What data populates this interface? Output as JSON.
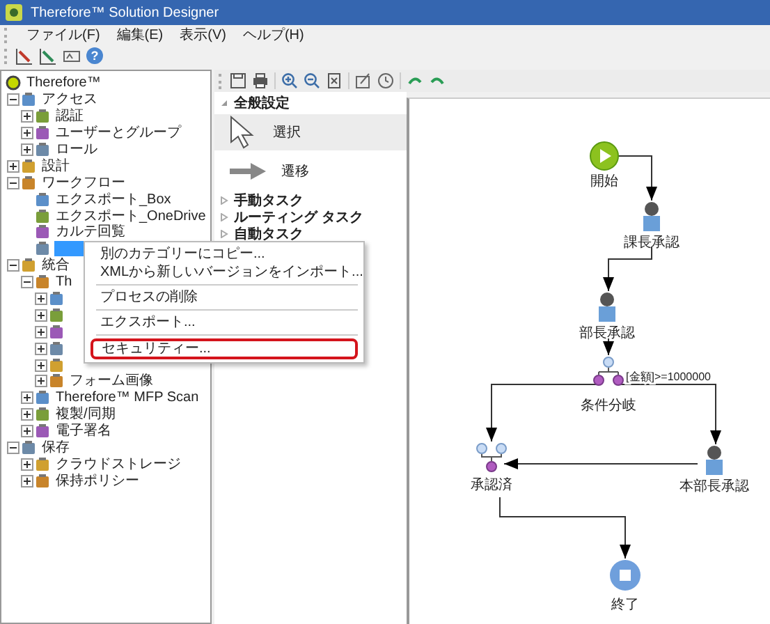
{
  "window": {
    "title": "Therefore™ Solution Designer"
  },
  "menu": [
    "ファイル(F)",
    "編集(E)",
    "表示(V)",
    "ヘルプ(H)"
  ],
  "toolbar": {
    "help": "?"
  },
  "tree": [
    {
      "label": "Therefore™",
      "children": [
        {
          "label": "アクセス",
          "expanded": true,
          "children": [
            {
              "label": "認証",
              "expanded": false
            },
            {
              "label": "ユーザーとグループ",
              "expanded": false
            },
            {
              "label": "ロール",
              "expanded": false
            }
          ]
        },
        {
          "label": "設計",
          "expanded": false
        },
        {
          "label": "ワークフロー",
          "expanded": true,
          "children": [
            {
              "label": "エクスポート_Box",
              "selected": false
            },
            {
              "label": "エクスポート_OneDrive",
              "selected": false
            },
            {
              "label": "カルテ回覧",
              "selected": false
            },
            {
              "selected": true
            }
          ]
        },
        {
          "label": "統合",
          "expanded": true,
          "children": [
            {
              "label": "Th",
              "expanded": true,
              "children": [
                {
                  "expanded": false
                },
                {
                  "expanded": false
                },
                {
                  "expanded": false
                },
                {
                  "expanded": false
                },
                {
                  "expanded": false
                },
                {
                  "label": "フォーム画像",
                  "expanded": false
                }
              ]
            },
            {
              "label": "Therefore™ MFP Scan",
              "expanded": false
            },
            {
              "label": "複製/同期",
              "expanded": false
            },
            {
              "label": "電子署名",
              "expanded": false
            }
          ]
        },
        {
          "label": "保存",
          "expanded": true,
          "children": [
            {
              "label": "クラウドストレージ",
              "expanded": false
            },
            {
              "label": "保持ポリシー",
              "expanded": false
            }
          ]
        }
      ]
    }
  ],
  "context_menu": [
    {
      "kind": "item",
      "label": "別のカテゴリーにコピー...",
      "highlighted": false
    },
    {
      "kind": "item",
      "label": "XMLから新しいバージョンをインポート...",
      "highlighted": false
    },
    {
      "kind": "separator"
    },
    {
      "kind": "item",
      "label": "プロセスの削除",
      "highlighted": false
    },
    {
      "kind": "separator"
    },
    {
      "kind": "item",
      "label": "エクスポート...",
      "highlighted": false
    },
    {
      "kind": "separator"
    },
    {
      "kind": "item",
      "label": "セキュリティー...",
      "highlighted": true
    }
  ],
  "palette": [
    {
      "label": "全般設定",
      "expanded": true,
      "tools": [
        {
          "kind": "pointer",
          "label": "選択",
          "selected": true
        },
        {
          "kind": "arrow",
          "label": "遷移",
          "selected": false
        }
      ]
    },
    {
      "label": "手動タスク",
      "expanded": false
    },
    {
      "label": "ルーティング タスク",
      "expanded": false
    },
    {
      "label": "自動タスク",
      "expanded": false
    }
  ],
  "diagram": {
    "nodes": [
      {
        "kind": "start",
        "label": "開始"
      },
      {
        "kind": "task",
        "label": "課長承認"
      },
      {
        "kind": "task",
        "label": "部長承認"
      },
      {
        "kind": "branch",
        "label": "条件分岐"
      },
      {
        "kind": "merge",
        "label": "承認済"
      },
      {
        "kind": "task",
        "label": "本部長承認"
      },
      {
        "kind": "end",
        "label": "終了"
      }
    ],
    "condition": "[金額]>=1000000"
  }
}
